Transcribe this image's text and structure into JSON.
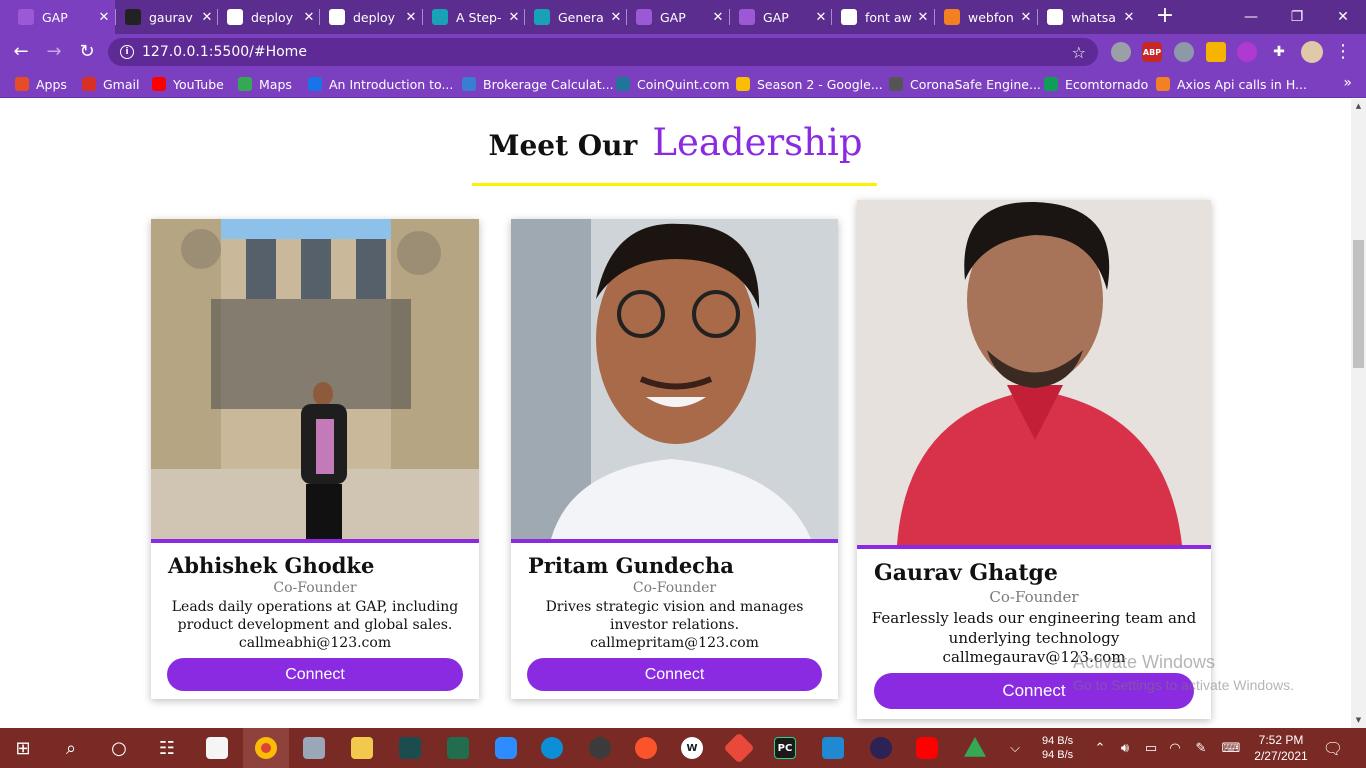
{
  "browser": {
    "tabs": [
      {
        "title": "GAP",
        "icon": "gap-favicon",
        "color": "#9b59d6"
      },
      {
        "title": "gaurav",
        "icon": "github-icon",
        "color": "#222222"
      },
      {
        "title": "deploy",
        "icon": "google-icon",
        "color": "#ffffff"
      },
      {
        "title": "deploy",
        "icon": "google-icon",
        "color": "#ffffff"
      },
      {
        "title": "A Step-",
        "icon": "diamond-icon",
        "color": "#17a2b8"
      },
      {
        "title": "Genera",
        "icon": "diamond-icon",
        "color": "#17a2b8"
      },
      {
        "title": "GAP",
        "icon": "gap-favicon",
        "color": "#9b59d6"
      },
      {
        "title": "GAP",
        "icon": "gap-favicon",
        "color": "#9b59d6"
      },
      {
        "title": "font aw",
        "icon": "google-icon",
        "color": "#ffffff"
      },
      {
        "title": "webfon",
        "icon": "stack-icon",
        "color": "#f48024"
      },
      {
        "title": "whatsa",
        "icon": "google-icon",
        "color": "#ffffff"
      }
    ],
    "close_glyph": "✕",
    "new_tab_glyph": "+",
    "window_controls": {
      "minimize": "—",
      "maximize": "❐",
      "close": "✕"
    },
    "url": "127.0.0.1:5500/#Home",
    "bookmarks": [
      {
        "label": "Apps",
        "icon": "apps-grid-icon",
        "color": "#e44d26"
      },
      {
        "label": "Gmail",
        "icon": "gmail-icon",
        "color": "#d93025"
      },
      {
        "label": "YouTube",
        "icon": "youtube-icon",
        "color": "#ff0000"
      },
      {
        "label": "Maps",
        "icon": "maps-icon",
        "color": "#34a853"
      },
      {
        "label": "An Introduction to...",
        "icon": "spin-icon",
        "color": "#1a73e8"
      },
      {
        "label": "Brokerage Calculat...",
        "icon": "zerodha-icon",
        "color": "#387ed1"
      },
      {
        "label": "CoinQuint.com",
        "icon": "wordpress-icon",
        "color": "#21759b"
      },
      {
        "label": "Season 2 - Google...",
        "icon": "drive-icon",
        "color": "#fbbc04"
      },
      {
        "label": "CoronaSafe Engine...",
        "icon": "globe-icon",
        "color": "#555555"
      },
      {
        "label": "Ecomtornado",
        "icon": "ecom-icon",
        "color": "#0f9d58"
      },
      {
        "label": "Axios Api calls in H...",
        "icon": "stack-icon",
        "color": "#f48024"
      }
    ],
    "bookmarks_more": "»"
  },
  "page": {
    "heading_part1": "Meet  Our",
    "heading_part2": "Leadership",
    "connect_label": "Connect",
    "colors": {
      "accent": "#8a2be2",
      "underline": "#fff200"
    },
    "leaders": [
      {
        "name": "Abhishek Ghodke",
        "role": "Co-Founder",
        "description": "Leads daily operations at GAP, including product development and global sales.",
        "email": "callmeabhi@123.com"
      },
      {
        "name": "Pritam Gundecha",
        "role": "Co-Founder",
        "description": "Drives strategic vision and manages investor relations.",
        "email": "callmepritam@123.com"
      },
      {
        "name": "Gaurav Ghatge",
        "role": "Co-Founder",
        "description": "Fearlessly leads our engineering team and underlying technology",
        "email": "callmegaurav@123.com"
      }
    ]
  },
  "watermark": {
    "line1": "Activate Windows",
    "line2": "Go to Settings to activate Windows."
  },
  "taskbar": {
    "network_up": "94 B/s",
    "network_down": "94 B/s",
    "time": "7:52 PM",
    "date": "2/27/2021"
  }
}
